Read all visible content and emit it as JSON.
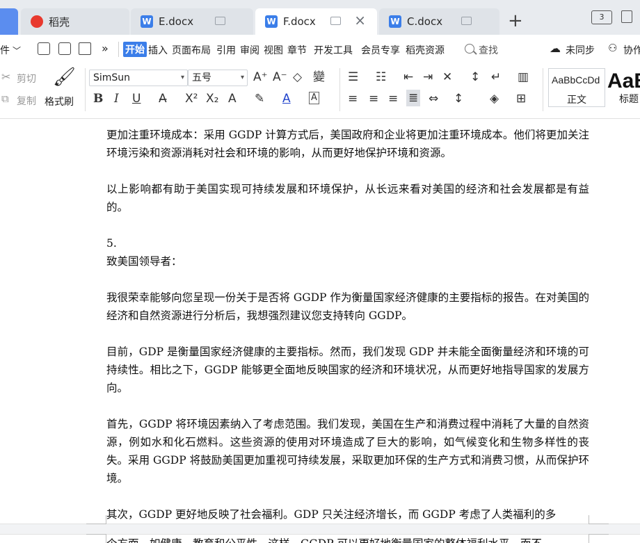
{
  "tabs": [
    {
      "label": "稻壳",
      "active": false
    },
    {
      "label": "E.docx",
      "active": false
    },
    {
      "label": "F.docx",
      "active": true
    },
    {
      "label": "C.docx",
      "active": false
    }
  ],
  "window": {
    "new_tab": "+",
    "layout_btn": "3"
  },
  "menu": {
    "file_partial": "件",
    "items": [
      "开始",
      "插入",
      "页面布局",
      "引用",
      "审阅",
      "视图",
      "章节",
      "开发工具",
      "会员专享",
      "稻壳资源"
    ],
    "search": "查找",
    "sync": "未同步",
    "collab": "协作"
  },
  "ribbon": {
    "cut": "剪切",
    "copy": "复制",
    "format_painter": "格式刷",
    "font_name": "SimSun",
    "font_size": "五号",
    "style_normal_preview": "AaBbCcDd",
    "style_normal": "正文",
    "style_heading_preview": "AaB",
    "style_heading": "标题"
  },
  "document": {
    "paragraphs": [
      "更加注重环境成本：采用 GGDP 计算方式后，美国政府和企业将更加注重环境成本。他们将更加关注环境污染和资源消耗对社会和环境的影响，从而更好地保护环境和资源。",
      "以上影响都有助于美国实现可持续发展和环境保护，从长远来看对美国的经济和社会发展都是有益的。",
      "5.",
      "致美国领导者：",
      "我很荣幸能够向您呈现一份关于是否将 GGDP 作为衡量国家经济健康的主要指标的报告。在对美国的经济和自然资源进行分析后，我想强烈建议您支持转向 GGDP。",
      "目前，GDP 是衡量国家经济健康的主要指标。然而，我们发现 GDP 并未能全面衡量经济和环境的可持续性。相比之下，GGDP 能够更全面地反映国家的经济和环境状况，从而更好地指导国家的发展方向。",
      "首先，GGDP 将环境因素纳入了考虑范围。我们发现，美国在生产和消费过程中消耗了大量的自然资源，例如水和化石燃料。这些资源的使用对环境造成了巨大的影响，如气候变化和生物多样性的丧失。采用 GGDP 将鼓励美国更加重视可持续发展，采取更加环保的生产方式和消费习惯，从而保护环境。",
      "其次，GGDP 更好地反映了社会福利。GDP 只关注经济增长，而 GGDP 考虑了人类福利的多",
      "个方面，如健康、教育和公平性。这样，GGDP 可以更好地衡量国家的整体福利水平，而不"
    ]
  }
}
